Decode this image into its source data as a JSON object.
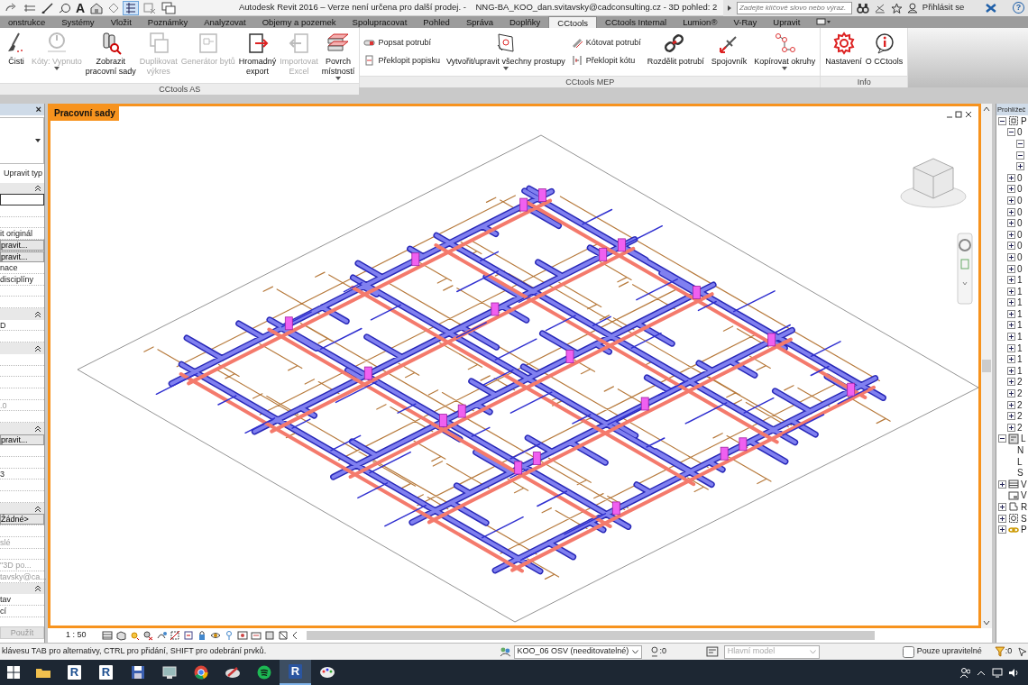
{
  "quick_access": {
    "text_tool": "A",
    "thin_lines": {
      "on": true
    }
  },
  "title_bar": {
    "title": "Autodesk Revit 2016 – Verze není určena pro další prodej. -    NNG-BA_KOO_dan.svitavsky@cadconsulting.cz - 3D pohled: 2",
    "search": {
      "placeholder": "Zadejte klíčové slovo nebo výraz."
    },
    "sign_in": "Přihlásit se",
    "help": "?"
  },
  "tabs": [
    {
      "label": "onstrukce",
      "selected": false
    },
    {
      "label": "Systémy",
      "selected": false
    },
    {
      "label": "Vložit",
      "selected": false
    },
    {
      "label": "Poznámky",
      "selected": false
    },
    {
      "label": "Analyzovat",
      "selected": false
    },
    {
      "label": "Objemy a pozemek",
      "selected": false
    },
    {
      "label": "Spolupracovat",
      "selected": false
    },
    {
      "label": "Pohled",
      "selected": false
    },
    {
      "label": "Správa",
      "selected": false
    },
    {
      "label": "Doplňky",
      "selected": false
    },
    {
      "label": "CCtools",
      "selected": true
    },
    {
      "label": "CCtools Internal",
      "selected": false
    },
    {
      "label": "Lumion®",
      "selected": false
    },
    {
      "label": "V-Ray",
      "selected": false
    },
    {
      "label": "Upravit",
      "selected": false
    }
  ],
  "ribbon": {
    "panels": [
      {
        "title": "CCtools AS",
        "buttons": [
          {
            "kind": "large",
            "label": "Čisti",
            "disabled": false,
            "dropdown": false
          },
          {
            "kind": "large",
            "label": "Kóty: Vypnuto",
            "disabled": true,
            "dropdown": true
          },
          {
            "kind": "large",
            "label": "Zobrazit\npracovní sady",
            "disabled": false,
            "dropdown": false
          },
          {
            "kind": "large",
            "label": "Duplikovat\nvýkres",
            "disabled": true,
            "dropdown": false
          },
          {
            "kind": "large",
            "label": "Generátor bytů",
            "disabled": true,
            "dropdown": false
          },
          {
            "kind": "large",
            "label": "Hromadný\nexport",
            "disabled": false,
            "dropdown": false
          },
          {
            "kind": "large",
            "label": "Importovat\nExcel",
            "disabled": true,
            "dropdown": false
          },
          {
            "kind": "large",
            "label": "Povrch\nmístností",
            "disabled": false,
            "dropdown": true
          }
        ]
      },
      {
        "title": "CCtools MEP",
        "buttons": [
          {
            "kind": "small",
            "label": "Popsat potrubí",
            "disabled": false,
            "dropdown": false
          },
          {
            "kind": "small",
            "label": "Překlopit popisku",
            "disabled": false,
            "dropdown": false
          },
          {
            "kind": "large",
            "label": "Vytvořit/upravit všechny prostupy",
            "disabled": false,
            "dropdown": true
          },
          {
            "kind": "small",
            "label": "Kótovat potrubí",
            "disabled": false,
            "dropdown": false
          },
          {
            "kind": "small",
            "label": "Překlopit kótu",
            "disabled": false,
            "dropdown": false
          },
          {
            "kind": "large",
            "label": "Rozdělit potrubí",
            "disabled": false,
            "dropdown": false
          },
          {
            "kind": "large",
            "label": "Spojovník",
            "disabled": false,
            "dropdown": false
          },
          {
            "kind": "large",
            "label": "Kopírovat okruhy",
            "disabled": false,
            "dropdown": true
          }
        ]
      },
      {
        "title": "Info",
        "buttons": [
          {
            "kind": "large",
            "label": "Nastavení",
            "disabled": false,
            "dropdown": false
          },
          {
            "kind": "large",
            "label": "O CCtools",
            "disabled": false,
            "dropdown": false
          }
        ]
      }
    ]
  },
  "properties": {
    "close": "×",
    "edit_type": "Upravit typ",
    "rows": [
      {
        "kind": "section"
      },
      {
        "kind": "input"
      },
      {
        "kind": "row"
      },
      {
        "kind": "row"
      },
      {
        "kind": "row",
        "text": "it originál",
        "disabled": false
      },
      {
        "kind": "button",
        "text": "pravit..."
      },
      {
        "kind": "button",
        "text": "pravit..."
      },
      {
        "kind": "row",
        "text": "nace",
        "disabled": false
      },
      {
        "kind": "row",
        "text": "disciplíny",
        "disabled": false
      },
      {
        "kind": "row"
      },
      {
        "kind": "row"
      },
      {
        "kind": "section"
      },
      {
        "kind": "row",
        "text": "D",
        "disabled": false
      },
      {
        "kind": "row"
      },
      {
        "kind": "section"
      },
      {
        "kind": "row"
      },
      {
        "kind": "row"
      },
      {
        "kind": "row"
      },
      {
        "kind": "row"
      },
      {
        "kind": "row",
        "text": ".0",
        "disabled": true
      },
      {
        "kind": "row"
      },
      {
        "kind": "section"
      },
      {
        "kind": "button",
        "text": "pravit..."
      },
      {
        "kind": "row"
      },
      {
        "kind": "row"
      },
      {
        "kind": "row",
        "text": "3",
        "disabled": false
      },
      {
        "kind": "row"
      },
      {
        "kind": "row"
      },
      {
        "kind": "section"
      },
      {
        "kind": "button",
        "text": "Žádné>"
      },
      {
        "kind": "row"
      },
      {
        "kind": "row",
        "text": "slé",
        "disabled": true
      },
      {
        "kind": "row"
      },
      {
        "kind": "row",
        "text": "\"3D po...",
        "disabled": true
      },
      {
        "kind": "row",
        "text": "tavsky@ca...",
        "disabled": true
      },
      {
        "kind": "section"
      },
      {
        "kind": "row",
        "text": "tav",
        "disabled": false
      },
      {
        "kind": "row",
        "text": "cí",
        "disabled": false
      }
    ],
    "apply": {
      "label": "Použít",
      "disabled": true
    }
  },
  "view": {
    "title": "Pracovní sady",
    "scale": "1 : 50"
  },
  "browser": {
    "title": "Prohlížeč",
    "tree": [
      {
        "label": "P",
        "kind": "views",
        "expanded": true,
        "children": [
          {
            "label": "0",
            "expanded": true,
            "children": [
              {
                "expanded": true
              },
              {
                "expanded": true
              },
              {
                "expanded": false
              }
            ]
          },
          {
            "label": "0",
            "expanded": false
          },
          {
            "label": "0",
            "expanded": false
          },
          {
            "label": "0",
            "expanded": false
          },
          {
            "label": "0",
            "expanded": false
          },
          {
            "label": "0",
            "expanded": false
          },
          {
            "label": "0",
            "expanded": false
          },
          {
            "label": "0",
            "expanded": false
          },
          {
            "label": "0",
            "expanded": false
          },
          {
            "label": "0",
            "expanded": false
          },
          {
            "label": "1",
            "expanded": false
          },
          {
            "label": "1",
            "expanded": false
          },
          {
            "label": "1",
            "expanded": false
          },
          {
            "label": "1",
            "expanded": false
          },
          {
            "label": "1",
            "expanded": false
          },
          {
            "label": "1",
            "expanded": false
          },
          {
            "label": "1",
            "expanded": false
          },
          {
            "label": "1",
            "expanded": false
          },
          {
            "label": "1",
            "expanded": false
          },
          {
            "label": "2",
            "expanded": false
          },
          {
            "label": "2",
            "expanded": false
          },
          {
            "label": "2",
            "expanded": false
          },
          {
            "label": "2",
            "expanded": false
          },
          {
            "label": "2",
            "expanded": false
          }
        ]
      },
      {
        "label": "L",
        "kind": "legends",
        "expanded": true,
        "children": [
          {
            "label": "N"
          },
          {
            "label": "L"
          },
          {
            "label": "S"
          }
        ]
      },
      {
        "label": "V",
        "kind": "schedules",
        "expanded": false
      },
      {
        "label": "V",
        "kind": "sheets"
      },
      {
        "label": "R",
        "kind": "families",
        "expanded": false
      },
      {
        "label": "S",
        "kind": "groups",
        "expanded": false
      },
      {
        "label": "P",
        "kind": "links",
        "expanded": false
      }
    ]
  },
  "status_bar": {
    "hint": "klávesu TAB pro alternativy, CTRL pro přidání, SHIFT pro odebrání prvků.",
    "workset": "KOO_06 OSV (needitovatelné)",
    "worksets_count": ":0",
    "design_option": {
      "value": "Hlavní model",
      "disabled": true
    },
    "editable_only": {
      "label": "Pouze upravitelné",
      "checked": false
    },
    "filter_count": ":0"
  },
  "taskbar": {
    "apps": [
      {
        "kind": "folder",
        "selected": false
      },
      {
        "kind": "revit",
        "label": "R",
        "selected": false
      },
      {
        "kind": "revit",
        "label": "R",
        "selected": false
      },
      {
        "kind": "save",
        "selected": false
      },
      {
        "kind": "viewer",
        "selected": false
      },
      {
        "kind": "chrome",
        "selected": false
      },
      {
        "kind": "paint",
        "selected": false
      },
      {
        "kind": "spotify",
        "selected": false
      },
      {
        "kind": "revit",
        "label": "R",
        "selected": true
      },
      {
        "kind": "palette",
        "selected": false
      }
    ]
  }
}
